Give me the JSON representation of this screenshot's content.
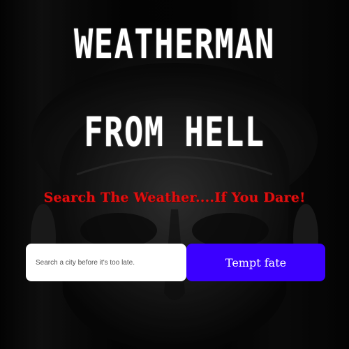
{
  "hero": {
    "title_line1": "WEATHERMAN",
    "title_line2": "FROM HELL",
    "tagline": "Search The Weather....If You Dare!"
  },
  "search": {
    "placeholder": "Search a city before it's too late.",
    "value": "",
    "button_label": "Tempt fate"
  },
  "colors": {
    "tagline": "#e01010",
    "button": "#3b00ff"
  }
}
